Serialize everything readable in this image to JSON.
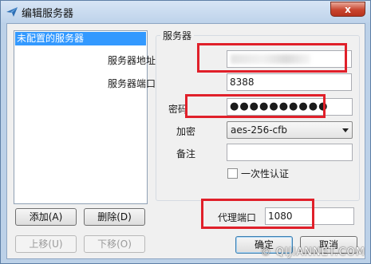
{
  "window": {
    "title": "编辑服务器",
    "close_glyph": "x"
  },
  "server_list": {
    "items": [
      "未配置的服务器"
    ]
  },
  "group": {
    "title": "服务器"
  },
  "form": {
    "address_label": "服务器地址",
    "address_value": "",
    "port_label": "服务器端口",
    "port_value": "8388",
    "password_label": "密码",
    "password_value": "●●●●●●●●●●",
    "encryption_label": "加密",
    "encryption_value": "aes-256-cfb",
    "remarks_label": "备注",
    "remarks_value": "",
    "onetime_auth_label": "一次性认证",
    "onetime_auth_checked": false,
    "proxy_port_label": "代理端口",
    "proxy_port_value": "1080"
  },
  "buttons": {
    "add": "添加(A)",
    "delete": "删除(D)",
    "move_up": "上移(U)",
    "move_down": "下移(O)",
    "ok": "确定",
    "cancel": "取消"
  },
  "watermark": "© QIJIANNET.COM",
  "colors": {
    "selection": "#3399ff",
    "annotation_box": "#e0202a",
    "titlebar": "#bdd2ea"
  }
}
